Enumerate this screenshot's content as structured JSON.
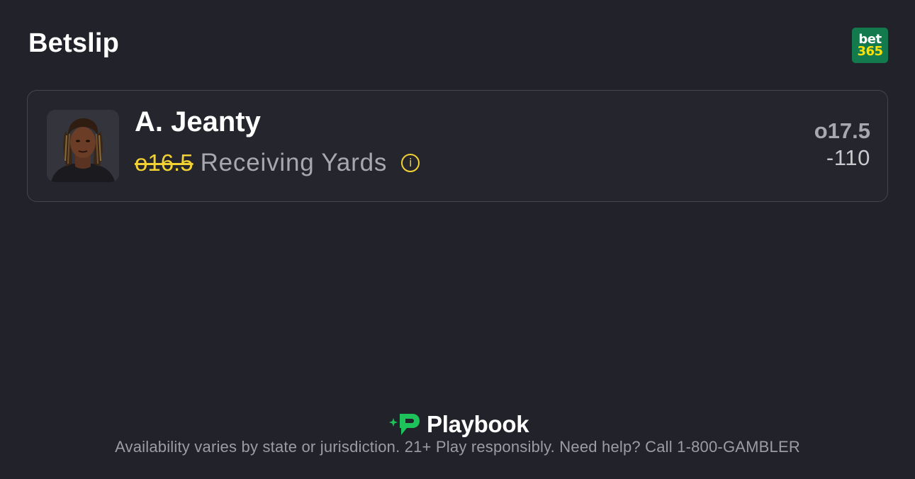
{
  "header": {
    "title": "Betslip",
    "sportsbook_logo": {
      "line1": "bet",
      "line2": "365",
      "icon": "bet365-logo",
      "background_color": "#137a4d",
      "accent_color": "#ffe000"
    }
  },
  "selection": {
    "player_name": "A. Jeanty",
    "old_line": "o16.5",
    "market": "Receiving Yards",
    "info_icon": "info-circle-icon",
    "new_line": "o17.5",
    "price": "-110"
  },
  "footer": {
    "brand": "Playbook",
    "brand_icon": "playbook-logo-icon",
    "brand_color": "#1ec25a",
    "disclaimer": "Availability varies by state or jurisdiction. 21+ Play responsibly. Need help? Call 1-800-GAMBLER"
  },
  "colors": {
    "background": "#22222a",
    "card_border": "#45454d",
    "highlight": "#f2d233"
  }
}
